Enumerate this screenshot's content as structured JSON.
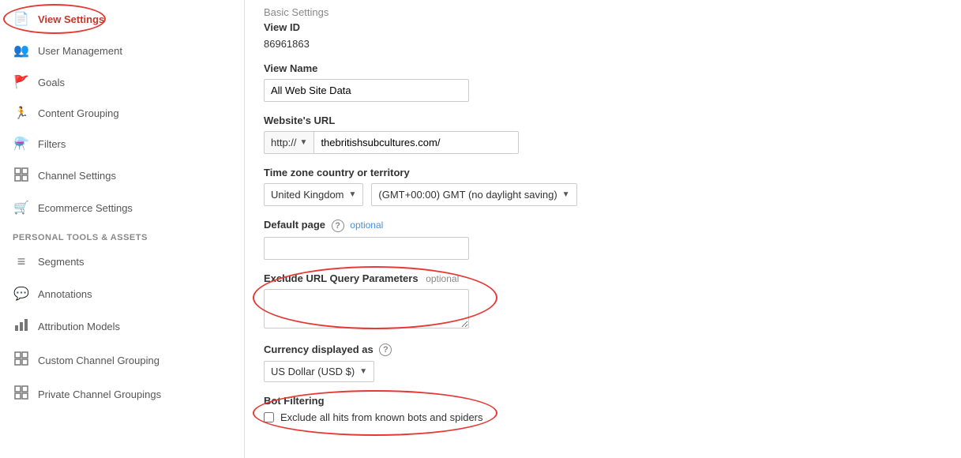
{
  "sidebar": {
    "sections": [
      {
        "items": [
          {
            "id": "view-settings",
            "label": "View Settings",
            "icon": "📄",
            "active": true
          },
          {
            "id": "user-management",
            "label": "User Management",
            "icon": "👥",
            "active": false
          },
          {
            "id": "goals",
            "label": "Goals",
            "icon": "🚩",
            "active": false
          },
          {
            "id": "content-grouping",
            "label": "Content Grouping",
            "icon": "🏃",
            "active": false
          },
          {
            "id": "filters",
            "label": "Filters",
            "icon": "⚗️",
            "active": false
          },
          {
            "id": "channel-settings",
            "label": "Channel Settings",
            "icon": "⊞",
            "active": false
          },
          {
            "id": "ecommerce-settings",
            "label": "Ecommerce Settings",
            "icon": "🛒",
            "active": false
          }
        ]
      },
      {
        "header": "PERSONAL TOOLS & ASSETS",
        "items": [
          {
            "id": "segments",
            "label": "Segments",
            "icon": "≡",
            "active": false
          },
          {
            "id": "annotations",
            "label": "Annotations",
            "icon": "💬",
            "active": false
          },
          {
            "id": "attribution-models",
            "label": "Attribution Models",
            "icon": "📊",
            "active": false
          },
          {
            "id": "custom-channel-grouping",
            "label": "Custom Channel Grouping",
            "icon": "⊞",
            "active": false
          },
          {
            "id": "private-channel-groupings",
            "label": "Private Channel Groupings",
            "icon": "⊞",
            "active": false
          }
        ]
      }
    ]
  },
  "main": {
    "breadcrumb": "Basic Settings",
    "view_id_label": "View ID",
    "view_id_value": "86961863",
    "view_name_label": "View Name",
    "view_name_value": "All Web Site Data",
    "website_url_label": "Website's URL",
    "protocol_value": "http://",
    "domain_value": "thebritishsubcultures.com/",
    "timezone_label": "Time zone country or territory",
    "timezone_country": "United Kingdom",
    "timezone_zone": "(GMT+00:00) GMT (no daylight saving)",
    "default_page_label": "Default page",
    "default_page_optional": "optional",
    "exclude_url_label": "Exclude URL Query Parameters",
    "exclude_url_optional": "optional",
    "currency_label": "Currency displayed as",
    "currency_value": "US Dollar (USD $)",
    "bot_filtering_label": "Bot Filtering",
    "bot_filtering_checkbox": "Exclude all hits from known bots and spiders"
  }
}
